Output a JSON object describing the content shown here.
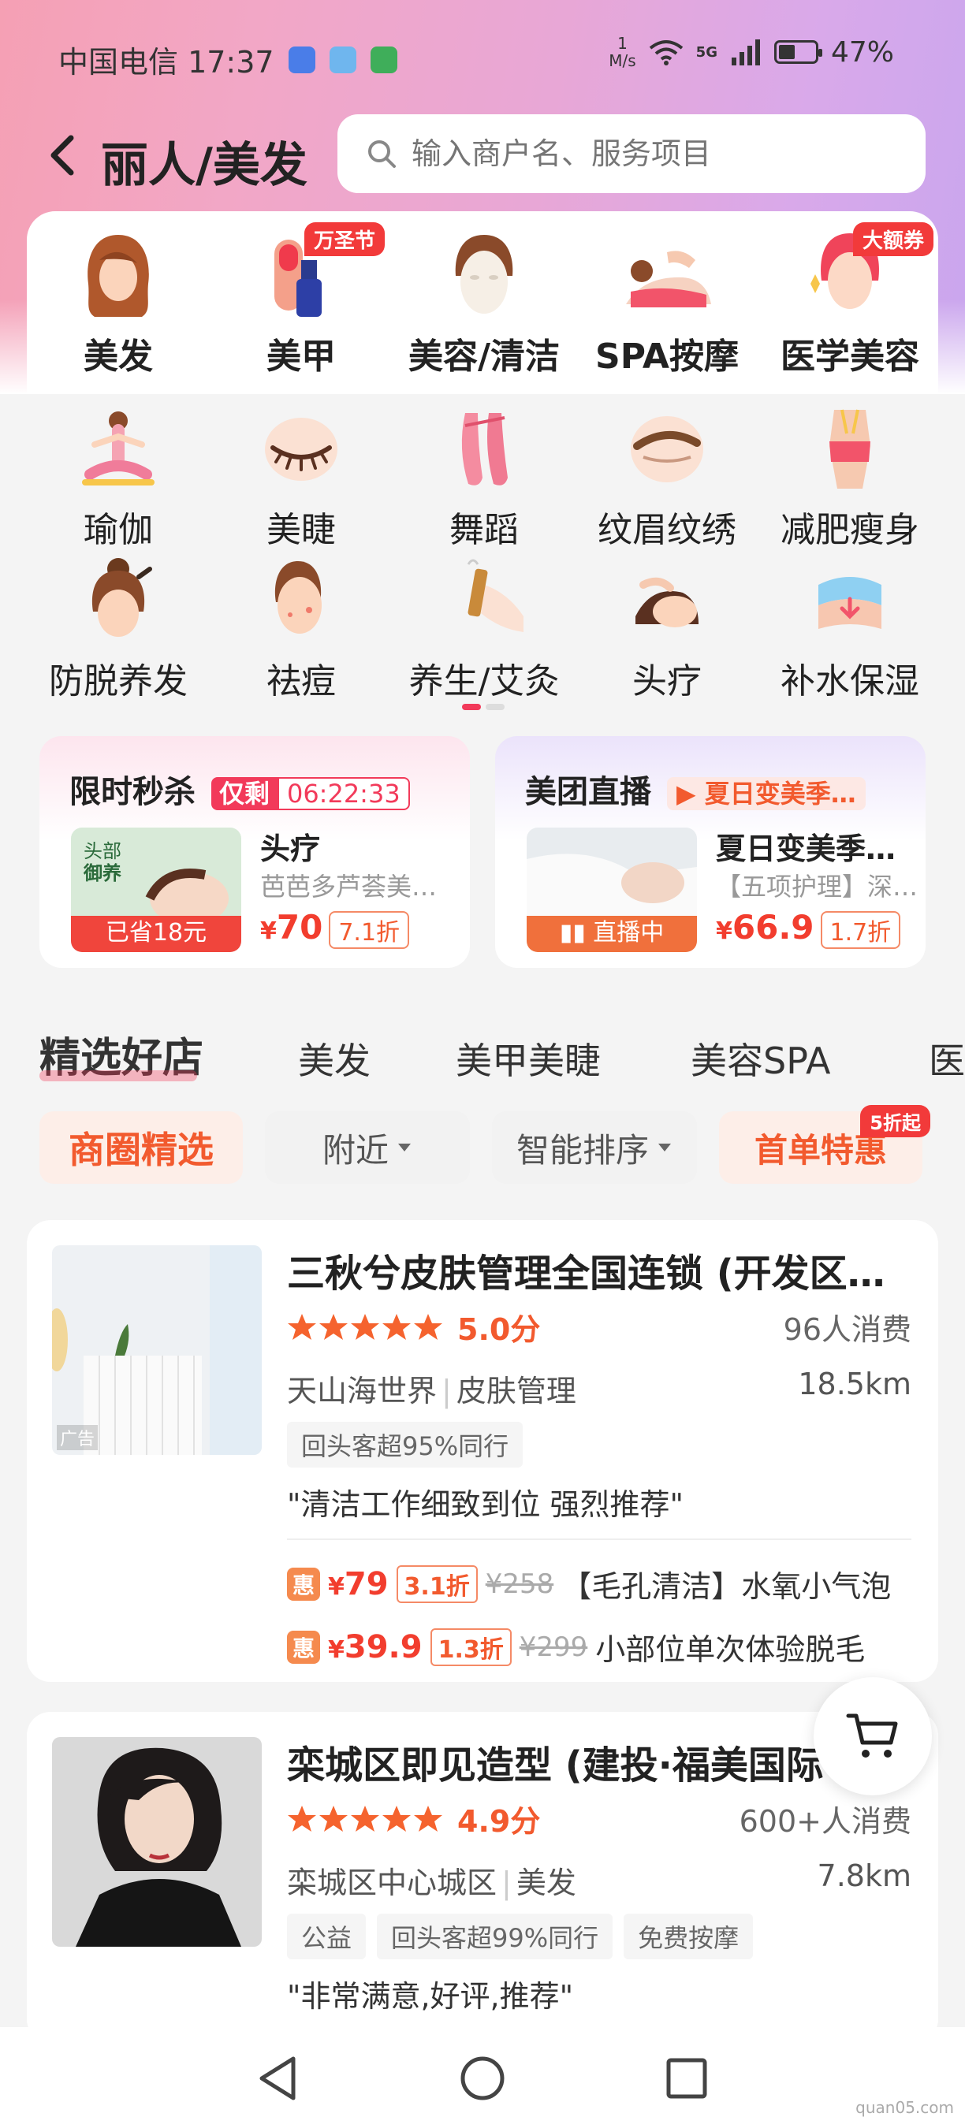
{
  "status_bar": {
    "carrier_time": "中国电信 17:37",
    "net_speed_value": "1",
    "net_speed_unit": "M/s",
    "network": "5G",
    "battery": "47%"
  },
  "header": {
    "title": "丽人/美发",
    "search_placeholder": "输入商户名、服务项目"
  },
  "categories": [
    {
      "label": "美发",
      "icon": "hair-icon"
    },
    {
      "label": "美甲",
      "icon": "nail-polish-icon",
      "badge": "万圣节"
    },
    {
      "label": "美容/清洁",
      "icon": "face-mask-icon"
    },
    {
      "label": "SPA按摩",
      "icon": "massage-icon"
    },
    {
      "label": "医学美容",
      "icon": "medical-beauty-icon",
      "badge": "大额券"
    },
    {
      "label": "瑜伽",
      "icon": "yoga-icon"
    },
    {
      "label": "美睫",
      "icon": "eyelash-icon"
    },
    {
      "label": "舞蹈",
      "icon": "ballet-shoes-icon"
    },
    {
      "label": "纹眉纹绣",
      "icon": "eyebrow-icon"
    },
    {
      "label": "减肥瘦身",
      "icon": "slimming-icon"
    },
    {
      "label": "防脱养发",
      "icon": "hair-care-icon"
    },
    {
      "label": "祛痘",
      "icon": "acne-icon"
    },
    {
      "label": "养生/艾灸",
      "icon": "moxibustion-icon"
    },
    {
      "label": "头疗",
      "icon": "head-spa-icon"
    },
    {
      "label": "补水保湿",
      "icon": "hydration-icon"
    }
  ],
  "flash_sale": {
    "title": "限时秒杀",
    "remaining_label": "仅剩",
    "countdown": "06:22:33",
    "thumb_text_1": "头部",
    "thumb_text_2": "御养",
    "saved": "已省18元",
    "item_name": "头疗",
    "item_sub": "芭芭多芦荟美…",
    "currency": "¥",
    "price": "70",
    "discount": "7.1折"
  },
  "live": {
    "title": "美团直播",
    "banner": "夏日变美季…",
    "live_label": "直播中",
    "item_name": "夏日变美季…",
    "item_sub": "【五项护理】深…",
    "currency": "¥",
    "price": "66.9",
    "discount": "1.7折"
  },
  "section_tabs": [
    "精选好店",
    "美发",
    "美甲美睫",
    "美容SPA",
    "医"
  ],
  "filters": {
    "business_area": "商圈精选",
    "nearby": "附近",
    "sort": "智能排序",
    "first_order": "首单特惠",
    "first_order_badge": "5折起"
  },
  "shops": [
    {
      "name": "三秋兮皮肤管理全国连锁 (开发区…",
      "rating": 5,
      "score": "5.0分",
      "count": "96人消费",
      "district": "天山海世界",
      "category": "皮肤管理",
      "distance": "18.5km",
      "ad_label": "广告",
      "tags": [
        "回头客超95%同行"
      ],
      "quote": "\"清洁工作细致到位 强烈推荐\"",
      "deals": [
        {
          "badge": "惠",
          "price": "79",
          "discount": "3.1折",
          "original": "¥258",
          "name": "【毛孔清洁】水氧小气泡"
        },
        {
          "badge": "惠",
          "price": "39.9",
          "discount": "1.3折",
          "original": "¥299",
          "name": "小部位单次体验脱毛"
        }
      ]
    },
    {
      "name": "栾城区即见造型 (建投·福美国际",
      "rating": 5,
      "score": "4.9分",
      "count": "600+人消费",
      "district": "栾城区中心城区",
      "category": "美发",
      "distance": "7.8km",
      "tags": [
        "公益",
        "回头客超99%同行",
        "免费按摩"
      ],
      "quote": "\"非常满意,好评,推荐\""
    }
  ],
  "watermark": "quan05.com",
  "colors": {
    "accent": "#f25a2e",
    "price": "#f23d2e",
    "badge": "#f23a3a",
    "star": "#f5632e"
  }
}
